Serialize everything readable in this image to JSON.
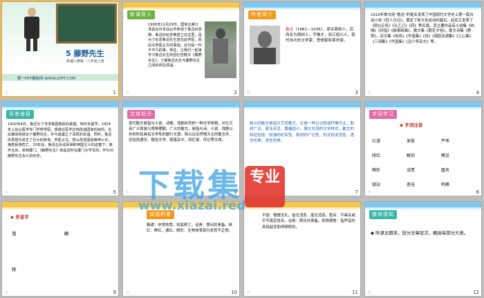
{
  "slides": [
    {
      "n": "1",
      "title": "5 藤野先生",
      "subtitle": "新编人教版 · 八年级上册",
      "footer": "第一PPT模板网-WWW.1PPT.COM"
    },
    {
      "n": "2",
      "tag": "新课导入",
      "text": "1906年11月29日，国家主席江泽民在日本仙台市参观了鲁迅纪念碑。鲁迅的纪念碑竖立在这里，是为了纪念鲁迅先生曾在此学医，而后又弃医从文的事迹。这可是一件不平凡的事。现在，让我们一起来学习鲁迅先生的回忆性散文《藤野先生》，了解鲁迅先生与藤野先生之间的师生情谊。"
    },
    {
      "n": "3",
      "tag": "作者简介",
      "name": "鲁迅",
      "text": "（1881—1936），原名周树人，后改名为周树人，字豫才，浙江绍兴人。现代伟大的文学家、思想家和革命家。"
    },
    {
      "n": "4",
      "text": "1918年首次用“鲁迅”的笔名发表了中国现代文学史上第一篇白话小说《狂人日记》，奠定了新文化运动的基石。此后又发表了《阿Q正传》《孔乙己》《药》等名篇。其主要作品有小说集《呐喊》《彷徨》《故事新编》，散文集《朝花夕拾》，散文诗集《野草》，杂文集《热风》《华盖集》《坟》《南腔北调集》《二心集》《三闲集》《华盖集》《且介亭杂文》等。"
    },
    {
      "n": "5",
      "tag": "背景链接",
      "text": "1902年4月，鲁迅为了寻求救国救民的真理，到日本留学。1904年入仙台医学专门学校学医。想通过医学达到改造国家的目的。在此期间他结识了藤野先生，并与其建立了深厚的友谊。同时，鲁迅的思想也发生了巨大的转变，弃医从文。想从改变国民精神入手，挽救民族危亡。20年后，鲁迅在反动军阀和帝国主义的迫害下，离开北京，来到厦门。《藤野先生》就是这时在厦门大学写的，作为对藤野先生永久的纪念。"
    },
    {
      "n": "6",
      "tag": "文体知识",
      "text": "现代散文是指与小说、诗歌、戏剧并列的一种文学体裁，对它又有广义和狭义两种理解。广义的散文，是指与诗、小说、戏剧以外的所有具有文学性的散行文章。除以议论抒情为主的散文外，还包括通讯、报告文学、随笔杂文、回忆录、传记等文体。"
    },
    {
      "n": "7",
      "text": "狭义的散文是指文艺性散文，它是一种以记叙或抒情为主，取材广泛、笔法灵活、篇幅短小、情文并茂的文学样式。散文的特征包括：较强的纪实性、取材的广泛性、形式的灵活性、语言优美、语言优美。"
    },
    {
      "n": "8",
      "tag": "字词学习",
      "head": "字词注音",
      "words": [
        "烂漫",
        "发髻",
        "芦苇",
        "绯红",
        "解剖",
        "瞧见",
        "畸形",
        "诘责",
        "匿名",
        "驿站",
        "杳无",
        "鸣嘶"
      ]
    },
    {
      "n": "9",
      "head": "多音字",
      "items": [
        "落",
        "瞭",
        "称"
      ]
    },
    {
      "n": "10",
      "tag": "词语积累",
      "text": "精通：非常熟悉，彻底明了。诘责：质问并责备。绯红：鲜红，通红。畸形：生物体某部分发育不正常。"
    },
    {
      "n": "11",
      "text": "不逊：傲慢无礼。杳无消息：毫无消息。匿名：不具名或不写真实姓名。诘责：质问并责备。抑扬顿挫：指声音的高低起伏和停顿转折。"
    },
    {
      "n": "12",
      "tag": "整体感知",
      "text": "听课文朗读，划分文章层次，概括每部分大意。"
    }
  ],
  "watermark": {
    "main": "下载集",
    "url": "www.xiazai.red",
    "badge": "专业"
  }
}
